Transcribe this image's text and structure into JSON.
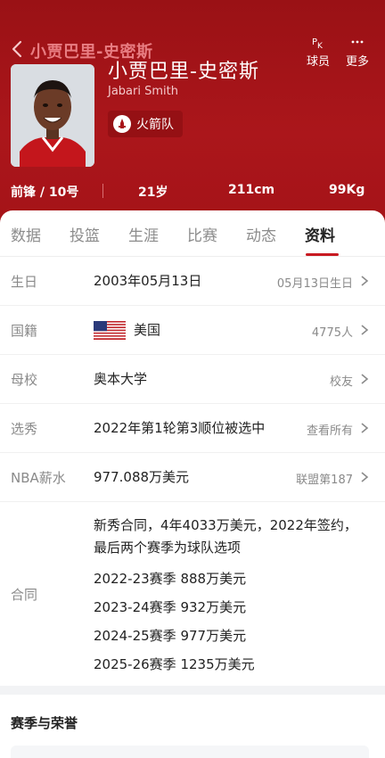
{
  "header": {
    "nav_title": "小贾巴里-史密斯",
    "actions": [
      {
        "glyph": "PK",
        "label": "球员"
      },
      {
        "glyph": "···",
        "label": "更多"
      }
    ]
  },
  "player": {
    "name_cn": "小贾巴里-史密斯",
    "name_en": "Jabari Smith",
    "team": "火箭队",
    "position": "前锋 / 10号",
    "age": "21岁",
    "height": "211cm",
    "weight": "99Kg"
  },
  "tabs": [
    {
      "label": "数据"
    },
    {
      "label": "投篮"
    },
    {
      "label": "生涯"
    },
    {
      "label": "比赛"
    },
    {
      "label": "动态"
    },
    {
      "label": "资料"
    }
  ],
  "profile": {
    "birthday": {
      "key": "生日",
      "value": "2003年05月13日",
      "right": "05月13日生日"
    },
    "nationality": {
      "key": "国籍",
      "value": "美国",
      "right": "4775人"
    },
    "school": {
      "key": "母校",
      "value": "奥本大学",
      "right": "校友"
    },
    "draft": {
      "key": "选秀",
      "value": "2022年第1轮第3顺位被选中",
      "right": "查看所有"
    },
    "salary": {
      "key": "NBA薪水",
      "value": "977.088万美元",
      "right": "联盟第187"
    },
    "contract": {
      "key": "合同",
      "summary": "新秀合同，4年4033万美元，2022年签约，最后两个赛季为球队选项",
      "seasons": [
        "2022-23赛季 888万美元",
        "2023-24赛季 932万美元",
        "2024-25赛季 977万美元",
        "2025-26赛季 1235万美元"
      ]
    }
  },
  "honors": {
    "title": "赛季与荣誉"
  },
  "colors": {
    "header_red": "#a81419",
    "accent_red": "#c81a22"
  }
}
